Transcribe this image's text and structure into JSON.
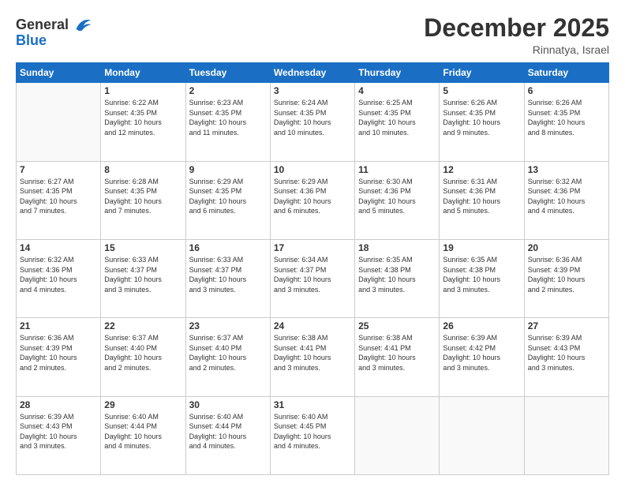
{
  "logo": {
    "text_general": "General",
    "text_blue": "Blue"
  },
  "title": "December 2025",
  "location": "Rinnatya, Israel",
  "days_of_week": [
    "Sunday",
    "Monday",
    "Tuesday",
    "Wednesday",
    "Thursday",
    "Friday",
    "Saturday"
  ],
  "weeks": [
    [
      {
        "day": "",
        "info": ""
      },
      {
        "day": "1",
        "info": "Sunrise: 6:22 AM\nSunset: 4:35 PM\nDaylight: 10 hours\nand 12 minutes."
      },
      {
        "day": "2",
        "info": "Sunrise: 6:23 AM\nSunset: 4:35 PM\nDaylight: 10 hours\nand 11 minutes."
      },
      {
        "day": "3",
        "info": "Sunrise: 6:24 AM\nSunset: 4:35 PM\nDaylight: 10 hours\nand 10 minutes."
      },
      {
        "day": "4",
        "info": "Sunrise: 6:25 AM\nSunset: 4:35 PM\nDaylight: 10 hours\nand 10 minutes."
      },
      {
        "day": "5",
        "info": "Sunrise: 6:26 AM\nSunset: 4:35 PM\nDaylight: 10 hours\nand 9 minutes."
      },
      {
        "day": "6",
        "info": "Sunrise: 6:26 AM\nSunset: 4:35 PM\nDaylight: 10 hours\nand 8 minutes."
      }
    ],
    [
      {
        "day": "7",
        "info": "Sunrise: 6:27 AM\nSunset: 4:35 PM\nDaylight: 10 hours\nand 7 minutes."
      },
      {
        "day": "8",
        "info": "Sunrise: 6:28 AM\nSunset: 4:35 PM\nDaylight: 10 hours\nand 7 minutes."
      },
      {
        "day": "9",
        "info": "Sunrise: 6:29 AM\nSunset: 4:35 PM\nDaylight: 10 hours\nand 6 minutes."
      },
      {
        "day": "10",
        "info": "Sunrise: 6:29 AM\nSunset: 4:36 PM\nDaylight: 10 hours\nand 6 minutes."
      },
      {
        "day": "11",
        "info": "Sunrise: 6:30 AM\nSunset: 4:36 PM\nDaylight: 10 hours\nand 5 minutes."
      },
      {
        "day": "12",
        "info": "Sunrise: 6:31 AM\nSunset: 4:36 PM\nDaylight: 10 hours\nand 5 minutes."
      },
      {
        "day": "13",
        "info": "Sunrise: 6:32 AM\nSunset: 4:36 PM\nDaylight: 10 hours\nand 4 minutes."
      }
    ],
    [
      {
        "day": "14",
        "info": "Sunrise: 6:32 AM\nSunset: 4:36 PM\nDaylight: 10 hours\nand 4 minutes."
      },
      {
        "day": "15",
        "info": "Sunrise: 6:33 AM\nSunset: 4:37 PM\nDaylight: 10 hours\nand 3 minutes."
      },
      {
        "day": "16",
        "info": "Sunrise: 6:33 AM\nSunset: 4:37 PM\nDaylight: 10 hours\nand 3 minutes."
      },
      {
        "day": "17",
        "info": "Sunrise: 6:34 AM\nSunset: 4:37 PM\nDaylight: 10 hours\nand 3 minutes."
      },
      {
        "day": "18",
        "info": "Sunrise: 6:35 AM\nSunset: 4:38 PM\nDaylight: 10 hours\nand 3 minutes."
      },
      {
        "day": "19",
        "info": "Sunrise: 6:35 AM\nSunset: 4:38 PM\nDaylight: 10 hours\nand 3 minutes."
      },
      {
        "day": "20",
        "info": "Sunrise: 6:36 AM\nSunset: 4:39 PM\nDaylight: 10 hours\nand 2 minutes."
      }
    ],
    [
      {
        "day": "21",
        "info": "Sunrise: 6:36 AM\nSunset: 4:39 PM\nDaylight: 10 hours\nand 2 minutes."
      },
      {
        "day": "22",
        "info": "Sunrise: 6:37 AM\nSunset: 4:40 PM\nDaylight: 10 hours\nand 2 minutes."
      },
      {
        "day": "23",
        "info": "Sunrise: 6:37 AM\nSunset: 4:40 PM\nDaylight: 10 hours\nand 2 minutes."
      },
      {
        "day": "24",
        "info": "Sunrise: 6:38 AM\nSunset: 4:41 PM\nDaylight: 10 hours\nand 3 minutes."
      },
      {
        "day": "25",
        "info": "Sunrise: 6:38 AM\nSunset: 4:41 PM\nDaylight: 10 hours\nand 3 minutes."
      },
      {
        "day": "26",
        "info": "Sunrise: 6:39 AM\nSunset: 4:42 PM\nDaylight: 10 hours\nand 3 minutes."
      },
      {
        "day": "27",
        "info": "Sunrise: 6:39 AM\nSunset: 4:43 PM\nDaylight: 10 hours\nand 3 minutes."
      }
    ],
    [
      {
        "day": "28",
        "info": "Sunrise: 6:39 AM\nSunset: 4:43 PM\nDaylight: 10 hours\nand 3 minutes."
      },
      {
        "day": "29",
        "info": "Sunrise: 6:40 AM\nSunset: 4:44 PM\nDaylight: 10 hours\nand 4 minutes."
      },
      {
        "day": "30",
        "info": "Sunrise: 6:40 AM\nSunset: 4:44 PM\nDaylight: 10 hours\nand 4 minutes."
      },
      {
        "day": "31",
        "info": "Sunrise: 6:40 AM\nSunset: 4:45 PM\nDaylight: 10 hours\nand 4 minutes."
      },
      {
        "day": "",
        "info": ""
      },
      {
        "day": "",
        "info": ""
      },
      {
        "day": "",
        "info": ""
      }
    ]
  ]
}
